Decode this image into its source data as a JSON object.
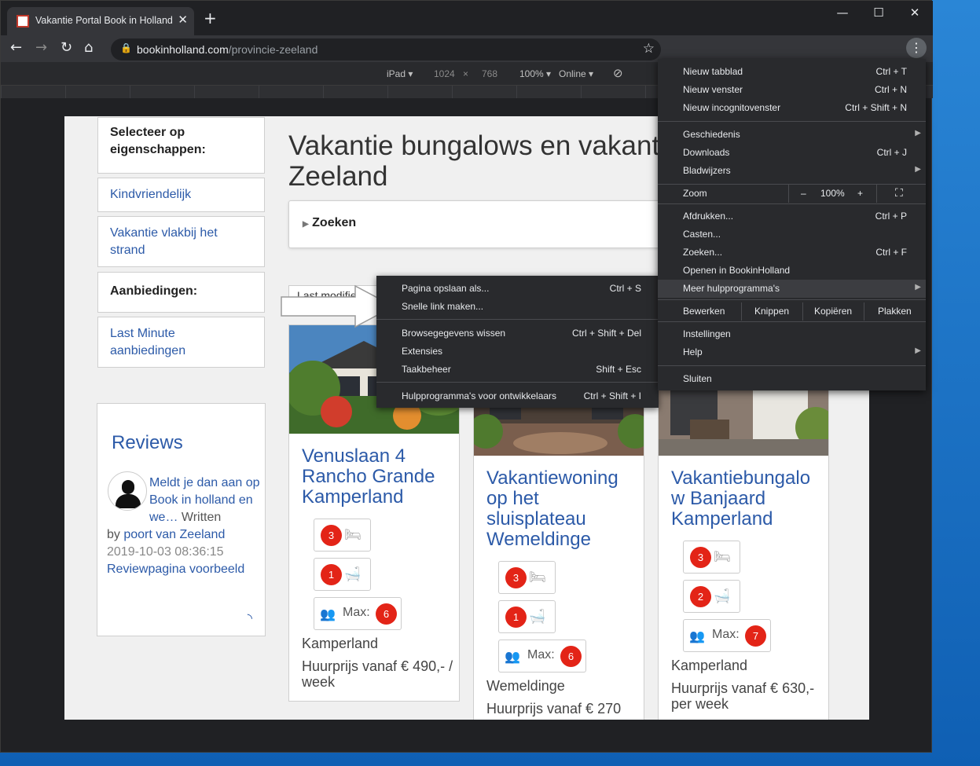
{
  "tab": {
    "title": "Vakantie Portal Book in Holland -",
    "close": "✕"
  },
  "new_tab": "+",
  "window_controls": {
    "minimize": "—",
    "maximize": "☐",
    "close": "✕"
  },
  "address": {
    "host": "bookinholland.com",
    "path": "/provincie-zeeland"
  },
  "device_bar": {
    "device": "iPad ▾",
    "width": "1024",
    "times": "×",
    "height": "768",
    "zoom": "100% ▾",
    "network": "Online ▾"
  },
  "sidebar": {
    "properties_heading": "Selecteer op eigenschappen:",
    "link_kids": "Kindvriendelijk",
    "link_beach": "Vakantie vlakbij het strand",
    "offers_heading": "Aanbiedingen:",
    "link_last_minute": "Last Minute aanbiedingen"
  },
  "reviews": {
    "title": "Reviews",
    "link": "Meldt je dan aan op Book in holland en we…",
    "written": "Written",
    "by": "by",
    "author": "poort van Zeeland",
    "date": "2019-10-03 08:36:15",
    "page_link": "Reviewpagina voorbeeld"
  },
  "main": {
    "heading": "Vakantie bungalows en vakantiehuizen in Zeeland",
    "search_label": "Zoeken",
    "sort_label": "Last modified"
  },
  "cards": [
    {
      "title": "Venuslaan 4 Rancho Grande Kamperland",
      "bedrooms": "3",
      "bathrooms": "1",
      "max_label": "Max:",
      "max": "6",
      "location": "Kamperland",
      "price": "Huurprijs vanaf € 490,- / week"
    },
    {
      "title": "Vakantiewoning op het sluisplateau Wemeldinge",
      "bedrooms": "3",
      "bathrooms": "1",
      "max_label": "Max:",
      "max": "6",
      "location": "Wemeldinge",
      "price": "Huurprijs vanaf € 270"
    },
    {
      "title": "Vakantiebungalo w Banjaard Kamperland",
      "bedrooms": "3",
      "bathrooms": "2",
      "max_label": "Max:",
      "max": "7",
      "location": "Kamperland",
      "price": "Huurprijs vanaf € 630,- per week"
    }
  ],
  "submenu": {
    "save_page": "Pagina opslaan als...",
    "save_page_sc": "Ctrl + S",
    "quick_link": "Snelle link maken...",
    "clear_data": "Browsegegevens wissen",
    "clear_data_sc": "Ctrl + Shift + Del",
    "extensions": "Extensies",
    "task_manager": "Taakbeheer",
    "task_manager_sc": "Shift + Esc",
    "dev_tools": "Hulpprogramma's voor ontwikkelaars",
    "dev_tools_sc": "Ctrl + Shift + I"
  },
  "menu": {
    "new_tab": "Nieuw tabblad",
    "new_tab_sc": "Ctrl + T",
    "new_window": "Nieuw venster",
    "new_window_sc": "Ctrl + N",
    "incognito": "Nieuw incognitovenster",
    "incognito_sc": "Ctrl + Shift + N",
    "history": "Geschiedenis",
    "downloads": "Downloads",
    "downloads_sc": "Ctrl + J",
    "bookmarks": "Bladwijzers",
    "zoom": "Zoom",
    "zoom_minus": "–",
    "zoom_value": "100%",
    "zoom_plus": "+",
    "print": "Afdrukken...",
    "print_sc": "Ctrl + P",
    "cast": "Casten...",
    "find": "Zoeken...",
    "find_sc": "Ctrl + F",
    "open_in": "Openen in BookinHolland",
    "more_tools": "Meer hulpprogramma's",
    "edit": "Bewerken",
    "cut": "Knippen",
    "copy": "Kopiëren",
    "paste": "Plakken",
    "settings": "Instellingen",
    "help": "Help",
    "exit": "Sluiten"
  }
}
